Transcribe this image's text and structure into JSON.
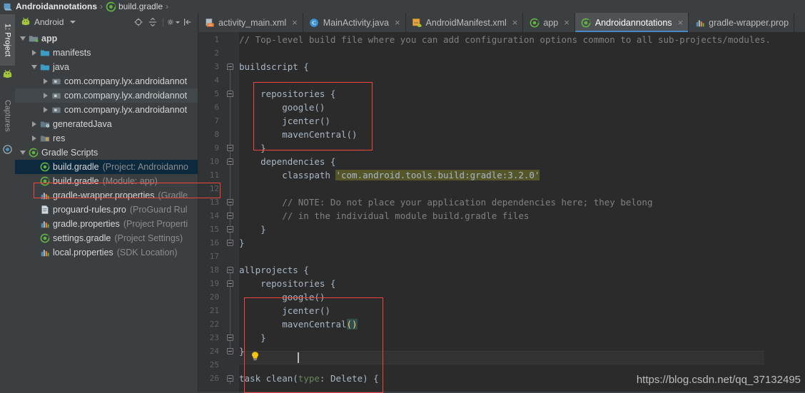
{
  "breadcrumb": {
    "items": [
      {
        "label": "Androidannotations",
        "icon": "android-project-icon",
        "bold": true
      },
      {
        "label": "build.gradle",
        "icon": "gradle-file-icon",
        "bold": false
      }
    ],
    "separator": "›"
  },
  "left_strip": {
    "tabs": [
      {
        "label": "1: Project",
        "icon": "android-head-icon",
        "active": true
      },
      {
        "label": "Captures",
        "icon": "capture-icon",
        "active": false
      }
    ]
  },
  "project_panel": {
    "selector_label": "Android",
    "selector_icon": "android-head-icon",
    "toolbar_icons": [
      {
        "name": "locate-target-icon",
        "title": "Select Opened File"
      },
      {
        "name": "collapse-all-icon",
        "title": "Collapse All"
      },
      {
        "name": "settings-gear-icon",
        "title": "Settings"
      },
      {
        "name": "hide-panel-icon",
        "title": "Hide"
      }
    ],
    "tree": [
      {
        "indent": 0,
        "twisty": "open",
        "icon": "module-folder-icon",
        "label": "app",
        "sub": "",
        "bold": true,
        "selected": false,
        "alt": false
      },
      {
        "indent": 1,
        "twisty": "closed",
        "icon": "folder-icon",
        "label": "manifests",
        "sub": "",
        "bold": false,
        "selected": false,
        "alt": false
      },
      {
        "indent": 1,
        "twisty": "open",
        "icon": "folder-icon",
        "label": "java",
        "sub": "",
        "bold": false,
        "selected": false,
        "alt": false
      },
      {
        "indent": 2,
        "twisty": "closed",
        "icon": "package-icon",
        "label": "com.company.lyx.androidannot",
        "sub": "",
        "bold": false,
        "selected": false,
        "alt": false
      },
      {
        "indent": 2,
        "twisty": "closed",
        "icon": "package-icon",
        "label": "com.company.lyx.androidannot",
        "sub": "",
        "bold": false,
        "selected": false,
        "alt": true
      },
      {
        "indent": 2,
        "twisty": "closed",
        "icon": "package-icon",
        "label": "com.company.lyx.androidannot",
        "sub": "",
        "bold": false,
        "selected": false,
        "alt": false
      },
      {
        "indent": 1,
        "twisty": "closed",
        "icon": "generated-folder-icon",
        "label": "generatedJava",
        "sub": "",
        "bold": false,
        "selected": false,
        "alt": false
      },
      {
        "indent": 1,
        "twisty": "closed",
        "icon": "res-folder-icon",
        "label": "res",
        "sub": "",
        "bold": false,
        "selected": false,
        "alt": false
      },
      {
        "indent": 0,
        "twisty": "open",
        "icon": "gradle-file-icon",
        "label": "Gradle Scripts",
        "sub": "",
        "bold": false,
        "selected": false,
        "alt": false
      },
      {
        "indent": 1,
        "twisty": "none",
        "icon": "gradle-file-icon",
        "label": "build.gradle",
        "sub": "(Project: Androidanno",
        "bold": false,
        "selected": true,
        "alt": false
      },
      {
        "indent": 1,
        "twisty": "none",
        "icon": "gradle-file-icon",
        "label": "build.gradle",
        "sub": "(Module: app)",
        "bold": false,
        "selected": false,
        "alt": false
      },
      {
        "indent": 1,
        "twisty": "none",
        "icon": "properties-icon",
        "label": "gradle-wrapper.properties",
        "sub": "(Gradle",
        "bold": false,
        "selected": false,
        "alt": false
      },
      {
        "indent": 1,
        "twisty": "none",
        "icon": "text-file-icon",
        "label": "proguard-rules.pro",
        "sub": "(ProGuard Rul",
        "bold": false,
        "selected": false,
        "alt": false
      },
      {
        "indent": 1,
        "twisty": "none",
        "icon": "properties-icon",
        "label": "gradle.properties",
        "sub": "(Project Properti",
        "bold": false,
        "selected": false,
        "alt": false
      },
      {
        "indent": 1,
        "twisty": "none",
        "icon": "gradle-file-icon",
        "label": "settings.gradle",
        "sub": "(Project Settings)",
        "bold": false,
        "selected": false,
        "alt": false
      },
      {
        "indent": 1,
        "twisty": "none",
        "icon": "properties-icon",
        "label": "local.properties",
        "sub": "(SDK Location)",
        "bold": false,
        "selected": false,
        "alt": false
      }
    ]
  },
  "editor": {
    "tabs": [
      {
        "label": "activity_main.xml",
        "icon": "layout-xml-icon",
        "active": false,
        "closable": true
      },
      {
        "label": "MainActivity.java",
        "icon": "java-class-icon",
        "active": false,
        "closable": true
      },
      {
        "label": "AndroidManifest.xml",
        "icon": "manifest-xml-icon",
        "active": false,
        "closable": true
      },
      {
        "label": "app",
        "icon": "gradle-file-icon",
        "active": false,
        "closable": true
      },
      {
        "label": "Androidannotations",
        "icon": "gradle-file-icon",
        "active": true,
        "closable": true
      },
      {
        "label": "gradle-wrapper.prop",
        "icon": "properties-icon",
        "active": false,
        "closable": false
      }
    ],
    "close_glyph": "×",
    "line_numbers": [
      1,
      2,
      3,
      4,
      5,
      6,
      7,
      8,
      9,
      10,
      11,
      12,
      13,
      14,
      15,
      16,
      17,
      18,
      19,
      20,
      21,
      22,
      23,
      24,
      25,
      26
    ],
    "current_line": 22,
    "caret_line": 22,
    "lightbulb_line": 22,
    "code_lines": [
      {
        "n": 1,
        "segments": [
          {
            "t": "// Top-level build file where you can add configuration options common to all sub-projects/modules.",
            "c": "cmt"
          }
        ]
      },
      {
        "n": 2,
        "segments": []
      },
      {
        "n": 3,
        "segments": [
          {
            "t": "buildscript {",
            "c": ""
          }
        ]
      },
      {
        "n": 4,
        "segments": []
      },
      {
        "n": 5,
        "segments": [
          {
            "t": "    repositories {",
            "c": ""
          }
        ]
      },
      {
        "n": 6,
        "segments": [
          {
            "t": "        google()",
            "c": ""
          }
        ]
      },
      {
        "n": 7,
        "segments": [
          {
            "t": "        jcenter()",
            "c": ""
          }
        ]
      },
      {
        "n": 8,
        "segments": [
          {
            "t": "        mavenCentral()",
            "c": ""
          }
        ]
      },
      {
        "n": 9,
        "segments": [
          {
            "t": "    }",
            "c": ""
          }
        ]
      },
      {
        "n": 10,
        "segments": [
          {
            "t": "    dependencies {",
            "c": ""
          }
        ]
      },
      {
        "n": 11,
        "segments": [
          {
            "t": "        classpath ",
            "c": ""
          },
          {
            "t": "'com.android.tools.build:gradle:3.2.0'",
            "c": "strbg"
          }
        ]
      },
      {
        "n": 12,
        "segments": []
      },
      {
        "n": 13,
        "segments": [
          {
            "t": "        // NOTE: Do not place your application dependencies here; they belong",
            "c": "cmt"
          }
        ]
      },
      {
        "n": 14,
        "segments": [
          {
            "t": "        // in the individual module build.gradle files",
            "c": "cmt"
          }
        ]
      },
      {
        "n": 15,
        "segments": [
          {
            "t": "    }",
            "c": ""
          }
        ]
      },
      {
        "n": 16,
        "segments": [
          {
            "t": "}",
            "c": ""
          }
        ]
      },
      {
        "n": 17,
        "segments": []
      },
      {
        "n": 18,
        "segments": [
          {
            "t": "allprojects {",
            "c": ""
          }
        ]
      },
      {
        "n": 19,
        "segments": [
          {
            "t": "    repositories {",
            "c": ""
          }
        ]
      },
      {
        "n": 20,
        "segments": [
          {
            "t": "        google()",
            "c": ""
          }
        ]
      },
      {
        "n": 21,
        "segments": [
          {
            "t": "        jcenter()",
            "c": ""
          }
        ]
      },
      {
        "n": 22,
        "segments": [
          {
            "t": "        mavenCentral",
            "c": ""
          },
          {
            "t": "()",
            "c": "brhl"
          }
        ]
      },
      {
        "n": 23,
        "segments": [
          {
            "t": "    }",
            "c": ""
          }
        ]
      },
      {
        "n": 24,
        "segments": [
          {
            "t": "}",
            "c": ""
          }
        ]
      },
      {
        "n": 25,
        "segments": []
      },
      {
        "n": 26,
        "segments": [
          {
            "t": "task clean(",
            "c": ""
          },
          {
            "t": "type",
            "c": "grn"
          },
          {
            "t": ": Delete) {",
            "c": ""
          }
        ]
      }
    ],
    "annotation_boxes": [
      {
        "name": "repositories-block-highlight",
        "line_start": 5,
        "line_end": 9
      },
      {
        "name": "allprojects-block-highlight",
        "line_start": 18,
        "line_end": 24
      }
    ]
  },
  "watermark": "https://blog.csdn.net/qq_37132495",
  "colors": {
    "panel_bg": "#3c3f41",
    "editor_bg": "#2b2b2b",
    "gutter_bg": "#313335",
    "selection_blue": "#0d293e",
    "tab_active": "#4e5254",
    "accent_underline": "#4a88c7",
    "annotation_red": "#f5453b",
    "comment_gray": "#808080",
    "string_green": "#6a8759",
    "string_bg": "#55552a",
    "bracket_highlight_bg": "#2f4f4f",
    "bracket_highlight_fg": "#ffc66d",
    "text_default": "#a9b7c6",
    "gradle_green": "#62b543"
  }
}
